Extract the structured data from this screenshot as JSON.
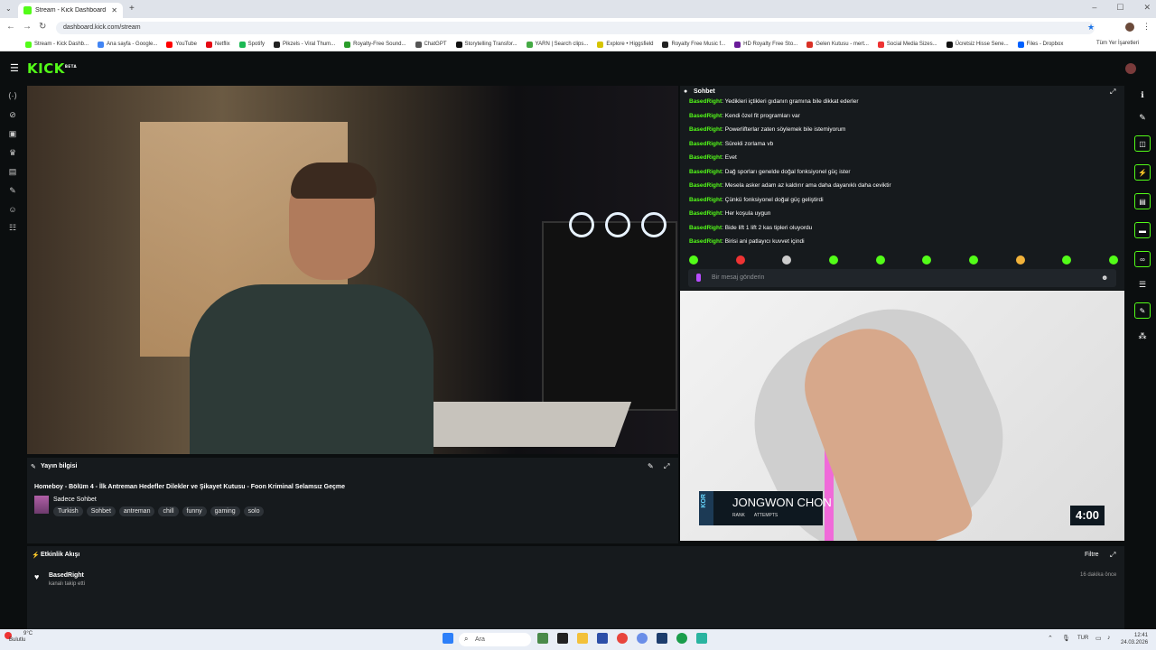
{
  "browser": {
    "tab_title": "Stream - Kick Dashboard",
    "url": "dashboard.kick.com/stream",
    "bookmarks": [
      "Stream - Kick Dashb...",
      "Ana sayfa - Google...",
      "YouTube",
      "Netflix",
      "Spotify",
      "Pikzels - Viral Thum...",
      "Royalty-Free Sound...",
      "ChatGPT",
      "Storytelling Transfor...",
      "YARN | Search clips...",
      "Explore • Higgsfield",
      "Royalty Free Music f...",
      "HD Royalty Free Sto...",
      "Gelen Kutusu - mert...",
      "Social Media Sizes...",
      "Ücretsiz Hisse Sene...",
      "Files - Dropbox"
    ],
    "bookmarks_all": "Tüm Yer İşaretleri"
  },
  "app": {
    "logo": "KICK",
    "logo_badge": "BETA"
  },
  "stream_info": {
    "label": "Yayın bilgisi",
    "title": "Homeboy - Bölüm 4 - İlk Antreman Hedefler Dilekler ve Şikayet Kutusu - Foon Kriminal Selamsız Geçme",
    "category": "Sadece Sohbet",
    "tags": [
      "Turkish",
      "Sohbet",
      "antreman",
      "chill",
      "funny",
      "gaming",
      "solo"
    ]
  },
  "activity": {
    "label": "Etkinlik Akışı",
    "filter": "Filtre",
    "user": "BasedRight",
    "desc": "kanalı takip etti",
    "time": "16 dakika önce"
  },
  "chat": {
    "title": "Sohbet",
    "messages": [
      {
        "user": "BasedRight",
        "text": "Yedikleri içtikleri gıdanın gramına bile dikkat ederler"
      },
      {
        "user": "BasedRight",
        "text": "Kendi özel fit programları var"
      },
      {
        "user": "BasedRight",
        "text": "Powerlifterlar zaten söylemek bile istemiyorum"
      },
      {
        "user": "BasedRight",
        "text": "Sürekli zorlama vb"
      },
      {
        "user": "BasedRight",
        "text": "Evet"
      },
      {
        "user": "BasedRight",
        "text": "Dağ sporları genelde doğal fonksiyonel güç ister"
      },
      {
        "user": "BasedRight",
        "text": "Mesela asker adam az kaldırır ama daha dayanıklı daha ceviktir"
      },
      {
        "user": "BasedRight",
        "text": "Çünkü fonksiyonel doğal güç geliştirdi"
      },
      {
        "user": "BasedRight",
        "text": "Her koşula uygun"
      },
      {
        "user": "BasedRight",
        "text": "Bide lift 1 lift 2 kas tipleri oluyordu"
      },
      {
        "user": "BasedRight",
        "text": "Birisi ani patlayıcı kuvvet içindi"
      }
    ],
    "input_placeholder": "Bir mesaj gönderin"
  },
  "mini_video": {
    "country": "KOR",
    "name": "JONGWON CHON",
    "stat1": "RANK",
    "stat2": "ATTEMPTS",
    "timer": "4:00"
  },
  "taskbar": {
    "weather_temp": "9°C",
    "weather_desc": "Bulutlu",
    "search": "Ara",
    "lang": "TUR",
    "time": "12:41",
    "date": "24.03.2026"
  },
  "colors": {
    "accent": "#53fc18",
    "panel": "#161a1d",
    "bg": "#0b0e0f"
  }
}
